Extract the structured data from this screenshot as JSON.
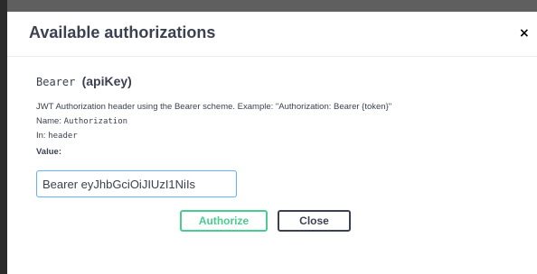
{
  "modal": {
    "title": "Available authorizations",
    "close_glyph": "×",
    "close_icon": "close-icon"
  },
  "scheme": {
    "name": "Bearer",
    "type": "(apiKey)",
    "description": "JWT Authorization header using the Bearer scheme. Example: \"Authorization: Bearer {token}\"",
    "name_label": "Name:",
    "name_value": "Authorization",
    "in_label": "In:",
    "in_value": "header",
    "value_label": "Value:",
    "value_input": "Bearer eyJhbGciOiJIUzI1NiIs"
  },
  "buttons": {
    "authorize": "Authorize",
    "close": "Close"
  },
  "colors": {
    "authorize_accent": "#49cc90",
    "input_focus_border": "#61affe",
    "text": "#3b4151"
  }
}
